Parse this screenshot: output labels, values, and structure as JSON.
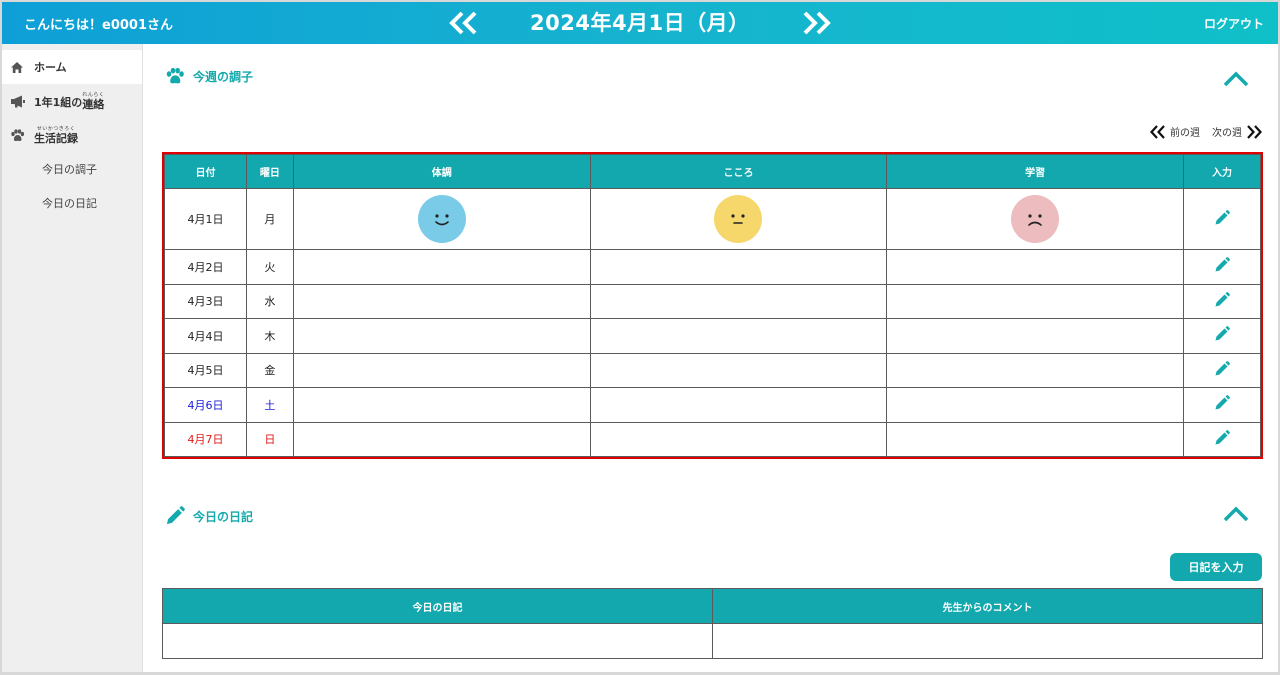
{
  "header": {
    "greeting": "こんにちは！e0001さん",
    "date": "2024年4月1日（月）",
    "logout": "ログアウト"
  },
  "sidebar": {
    "home": "ホーム",
    "contact": {
      "prefix": "1年1組の",
      "word": "連絡",
      "ruby": "れんらく"
    },
    "life": {
      "word": "生活記録",
      "ruby": "せいかつきろく"
    },
    "sub_items": [
      "今日の調子",
      "今日の日記"
    ]
  },
  "weekly": {
    "title": "今週の調子",
    "prev_week": "前の週",
    "next_week": "次の週",
    "headers": [
      "日付",
      "曜日",
      "体調",
      "こころ",
      "学習",
      "入力"
    ],
    "rows": [
      {
        "date": "4月1日",
        "day": "月",
        "type": "weekday",
        "moods": {
          "health": "smile",
          "heart": "neutral",
          "study": "sad"
        }
      },
      {
        "date": "4月2日",
        "day": "火",
        "type": "weekday"
      },
      {
        "date": "4月3日",
        "day": "水",
        "type": "weekday"
      },
      {
        "date": "4月4日",
        "day": "木",
        "type": "weekday"
      },
      {
        "date": "4月5日",
        "day": "金",
        "type": "weekday"
      },
      {
        "date": "4月6日",
        "day": "土",
        "type": "saturday"
      },
      {
        "date": "4月7日",
        "day": "日",
        "type": "sunday"
      }
    ]
  },
  "diary": {
    "title": "今日の日記",
    "input_button": "日記を入力",
    "headers": [
      "今日の日記",
      "先生からのコメント"
    ]
  },
  "colors": {
    "accent": "#13a8ad",
    "highlight_border": "#e00000",
    "saturday": "#1a1adb",
    "sunday": "#e01919",
    "face_smile": "#79cbe8",
    "face_neutral": "#f6d76c",
    "face_sad": "#ecbcbe"
  },
  "icons": {
    "home": "home-icon",
    "contact": "megaphone-icon",
    "life": "paw-icon",
    "edit": "pencil-icon",
    "collapse": "chevron-up-icon"
  }
}
